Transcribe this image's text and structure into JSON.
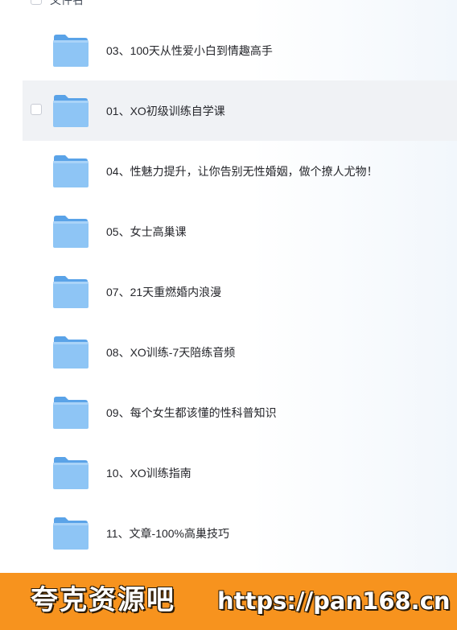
{
  "header": {
    "column_label": "文件名"
  },
  "files": [
    {
      "name": "03、100天从性爱小白到情趣高手",
      "icon": "folder-icon",
      "hovered": false
    },
    {
      "name": "01、XO初级训练自学课",
      "icon": "folder-icon",
      "hovered": true
    },
    {
      "name": "04、性魅力提升，让你告别无性婚姻，做个撩人尤物！",
      "icon": "folder-icon",
      "hovered": false
    },
    {
      "name": "05、女士高巢课",
      "icon": "folder-icon",
      "hovered": false
    },
    {
      "name": "07、21天重燃婚内浪漫",
      "icon": "folder-icon",
      "hovered": false
    },
    {
      "name": "08、XO训练-7天陪练音频",
      "icon": "folder-icon",
      "hovered": false
    },
    {
      "name": "09、每个女生都该懂的性科普知识",
      "icon": "folder-icon",
      "hovered": false
    },
    {
      "name": "10、XO训练指南",
      "icon": "folder-icon",
      "hovered": false
    },
    {
      "name": "11、文章-100%高巢技巧",
      "icon": "folder-icon",
      "hovered": false
    }
  ],
  "banner": {
    "brand": "夸克资源吧",
    "url": "https://pan168.cn"
  },
  "colors": {
    "folder_back": "#5aa3e8",
    "folder_front": "#8ec5f5",
    "hover_row": "#f0f2f5",
    "banner": "#f7931e"
  }
}
